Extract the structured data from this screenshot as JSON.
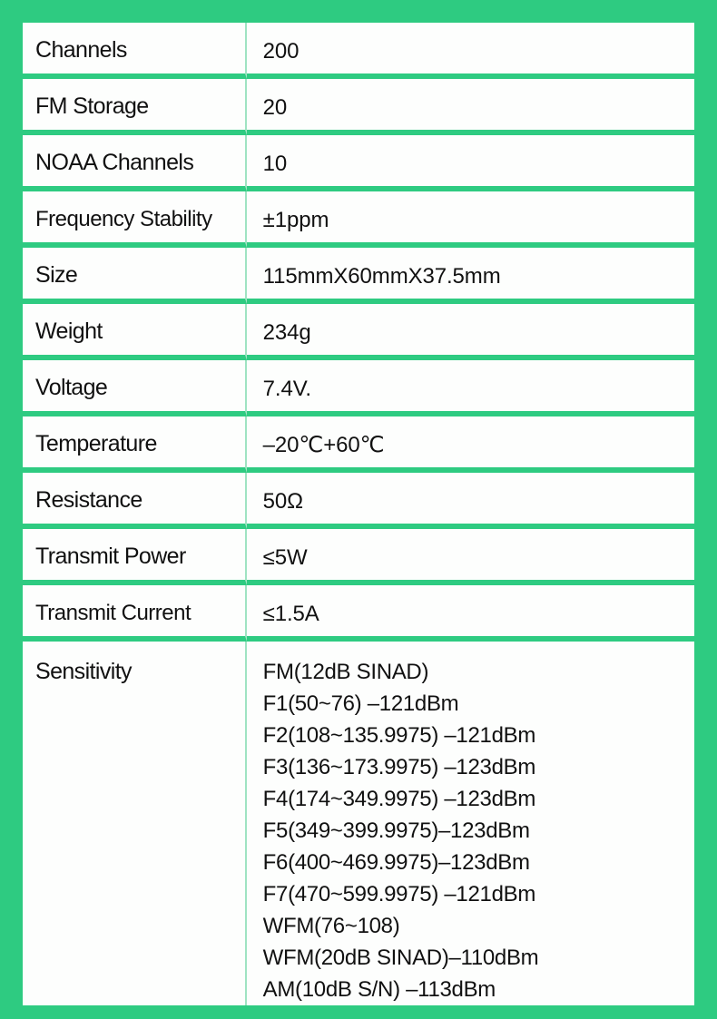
{
  "document": {
    "type": "product-specification-table",
    "accent_color": "#2ecb81",
    "cell_background": "#fdfefd",
    "text_color": "#111111",
    "divider_color": "#9fe3c2"
  },
  "table": {
    "rows": [
      {
        "label": "Channels",
        "value": "200"
      },
      {
        "label": "FM Storage",
        "value": "20"
      },
      {
        "label": "NOAA Channels",
        "value": "10"
      },
      {
        "label": "Frequency Stability",
        "value": "±1ppm"
      },
      {
        "label": "Size",
        "value": "115mmX60mmX37.5mm"
      },
      {
        "label": "Weight",
        "value": "234g"
      },
      {
        "label": "Voltage",
        "value": "7.4V."
      },
      {
        "label": "Temperature",
        "value": "–20℃+60℃"
      },
      {
        "label": "Resistance",
        "value": "50Ω"
      },
      {
        "label": "Transmit Power",
        "value": "≤5W"
      },
      {
        "label": "Transmit Current",
        "value": "≤1.5A"
      }
    ],
    "sensitivity": {
      "label": "Sensitivity",
      "lines": [
        "FM(12dB SINAD)",
        "F1(50~76) –121dBm",
        "F2(108~135.9975) –121dBm",
        "F3(136~173.9975) –123dBm",
        "F4(174~349.9975) –123dBm",
        "F5(349~399.9975)–123dBm",
        "F6(400~469.9975)–123dBm",
        "F7(470~599.9975) –121dBm",
        "WFM(76~108)",
        "WFM(20dB SINAD)–110dBm",
        "AM(10dB S/N) –113dBm"
      ]
    }
  }
}
